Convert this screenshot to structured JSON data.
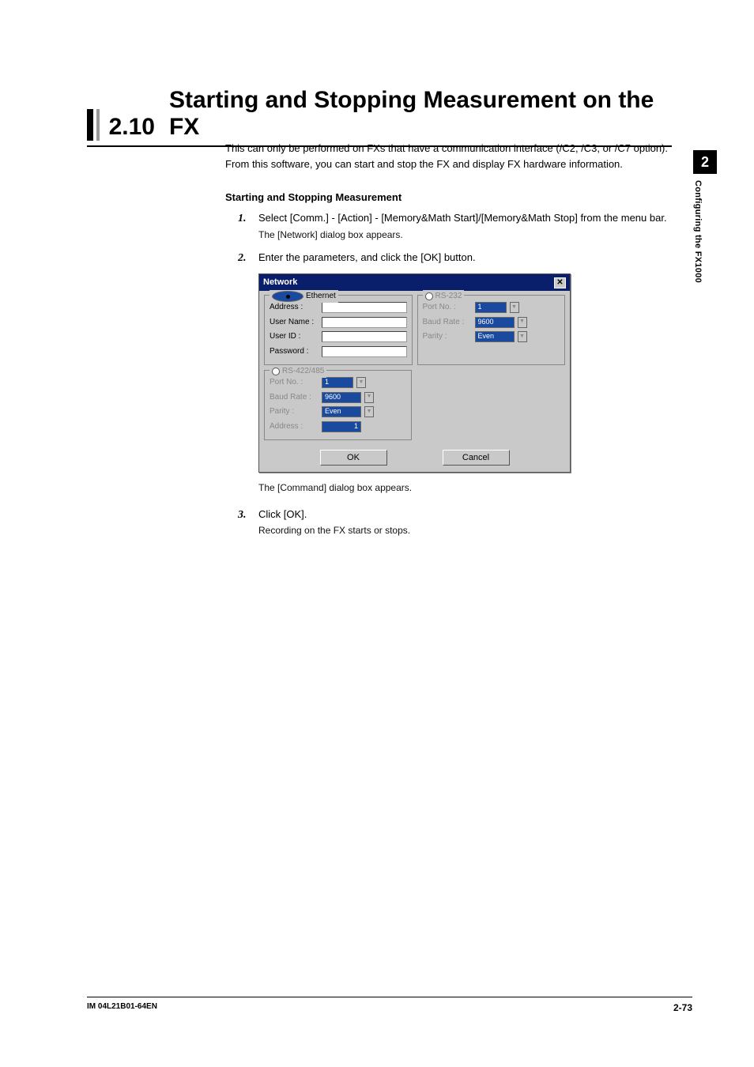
{
  "sideTab": {
    "number": "2",
    "label": "Configuring the FX1000"
  },
  "heading": {
    "num": "2.10",
    "title": "Starting and Stopping Measurement on the FX"
  },
  "intro": "This can only be performed on FXs that have a communication interface (/C2, /C3, or /C7 option). From this software, you can start and stop the FX and display FX hardware information.",
  "subhead": "Starting and Stopping Measurement",
  "steps": [
    {
      "n": "1.",
      "main": "Select [Comm.] - [Action] - [Memory&Math Start]/[Memory&Math Stop] from the menu bar.",
      "sub": "The [Network] dialog box appears."
    },
    {
      "n": "2.",
      "main": "Enter the parameters, and click the [OK] button."
    },
    {
      "n": "3.",
      "main": "Click [OK].",
      "sub": "Recording on the FX starts or stops."
    }
  ],
  "afterDialog": "The [Command] dialog box appears.",
  "dialog": {
    "title": "Network",
    "ethernet": {
      "legend": "Ethernet",
      "rows": [
        {
          "label": "Address :"
        },
        {
          "label": "User Name :"
        },
        {
          "label": "User ID :"
        },
        {
          "label": "Password :"
        }
      ]
    },
    "rs232": {
      "legend": "RS-232",
      "rows": [
        {
          "label": "Port No. :",
          "value": "1"
        },
        {
          "label": "Baud Rate :",
          "value": "9600"
        },
        {
          "label": "Parity :",
          "value": "Even"
        }
      ]
    },
    "rs422": {
      "legend": "RS-422/485",
      "rows": [
        {
          "label": "Port No. :",
          "value": "1"
        },
        {
          "label": "Baud Rate :",
          "value": "9600"
        },
        {
          "label": "Parity :",
          "value": "Even"
        },
        {
          "label": "Address :",
          "value": "1"
        }
      ]
    },
    "ok": "OK",
    "cancel": "Cancel"
  },
  "footer": {
    "doc": "IM 04L21B01-64EN",
    "page": "2-73"
  }
}
